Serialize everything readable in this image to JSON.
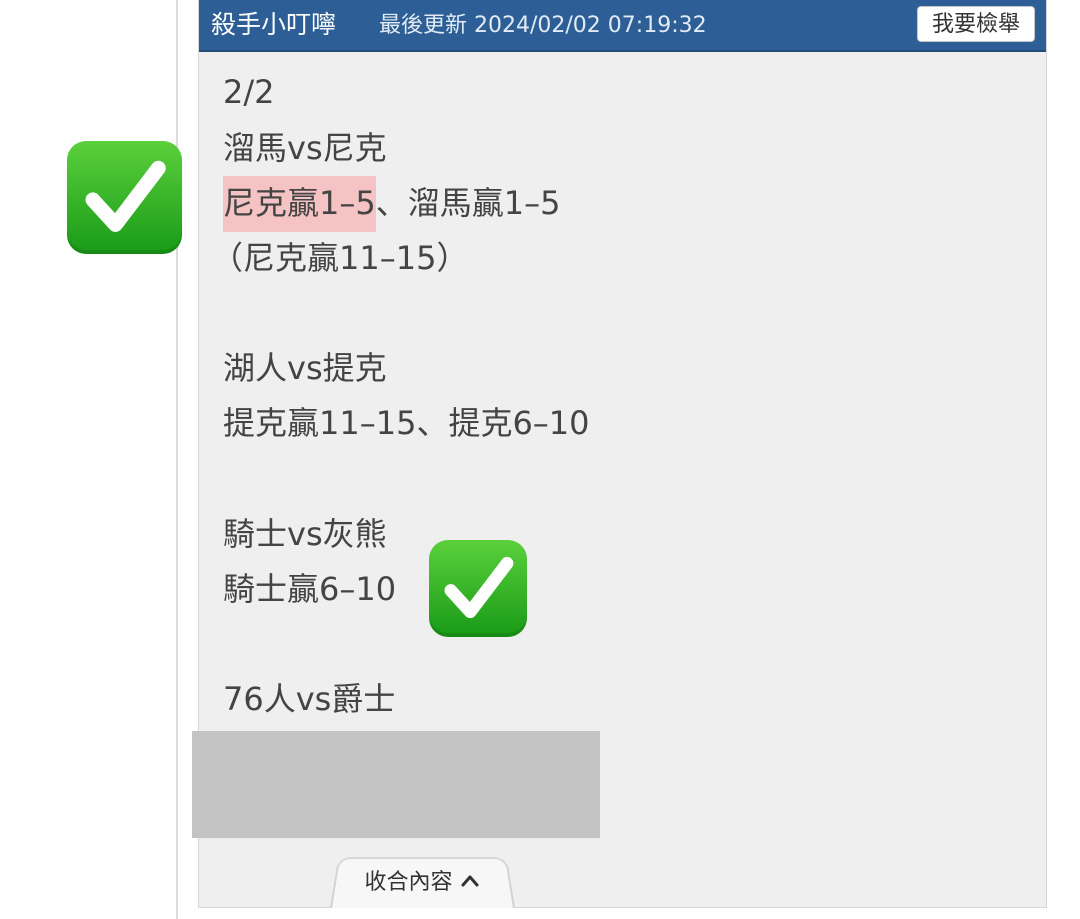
{
  "header": {
    "author": "殺手小叮嚀",
    "updated": "最後更新 2024/02/02 07:19:32",
    "report_label": "我要檢舉"
  },
  "post": {
    "date": "2/2",
    "g1_title": "溜馬vs尼克",
    "g1_pick_hl": "尼克贏1–5",
    "g1_pick_rest": "、溜馬贏1–5",
    "g1_note": "（尼克贏11–15）",
    "g2_title": "湖人vs提克",
    "g2_pick": "提克贏11–15、提克6–10",
    "g3_title": "騎士vs灰熊",
    "g3_pick": "騎士贏6–10",
    "g4_title": "76人vs爵士"
  },
  "footer": {
    "collapse_label": "收合內容"
  },
  "icons": {
    "check": "check-mark-button-icon",
    "collapse": "chevron-up-icon"
  },
  "colors": {
    "header_bg": "#2d5f96",
    "highlight": "#f5c3c3",
    "check_green": "#2fb52a"
  }
}
